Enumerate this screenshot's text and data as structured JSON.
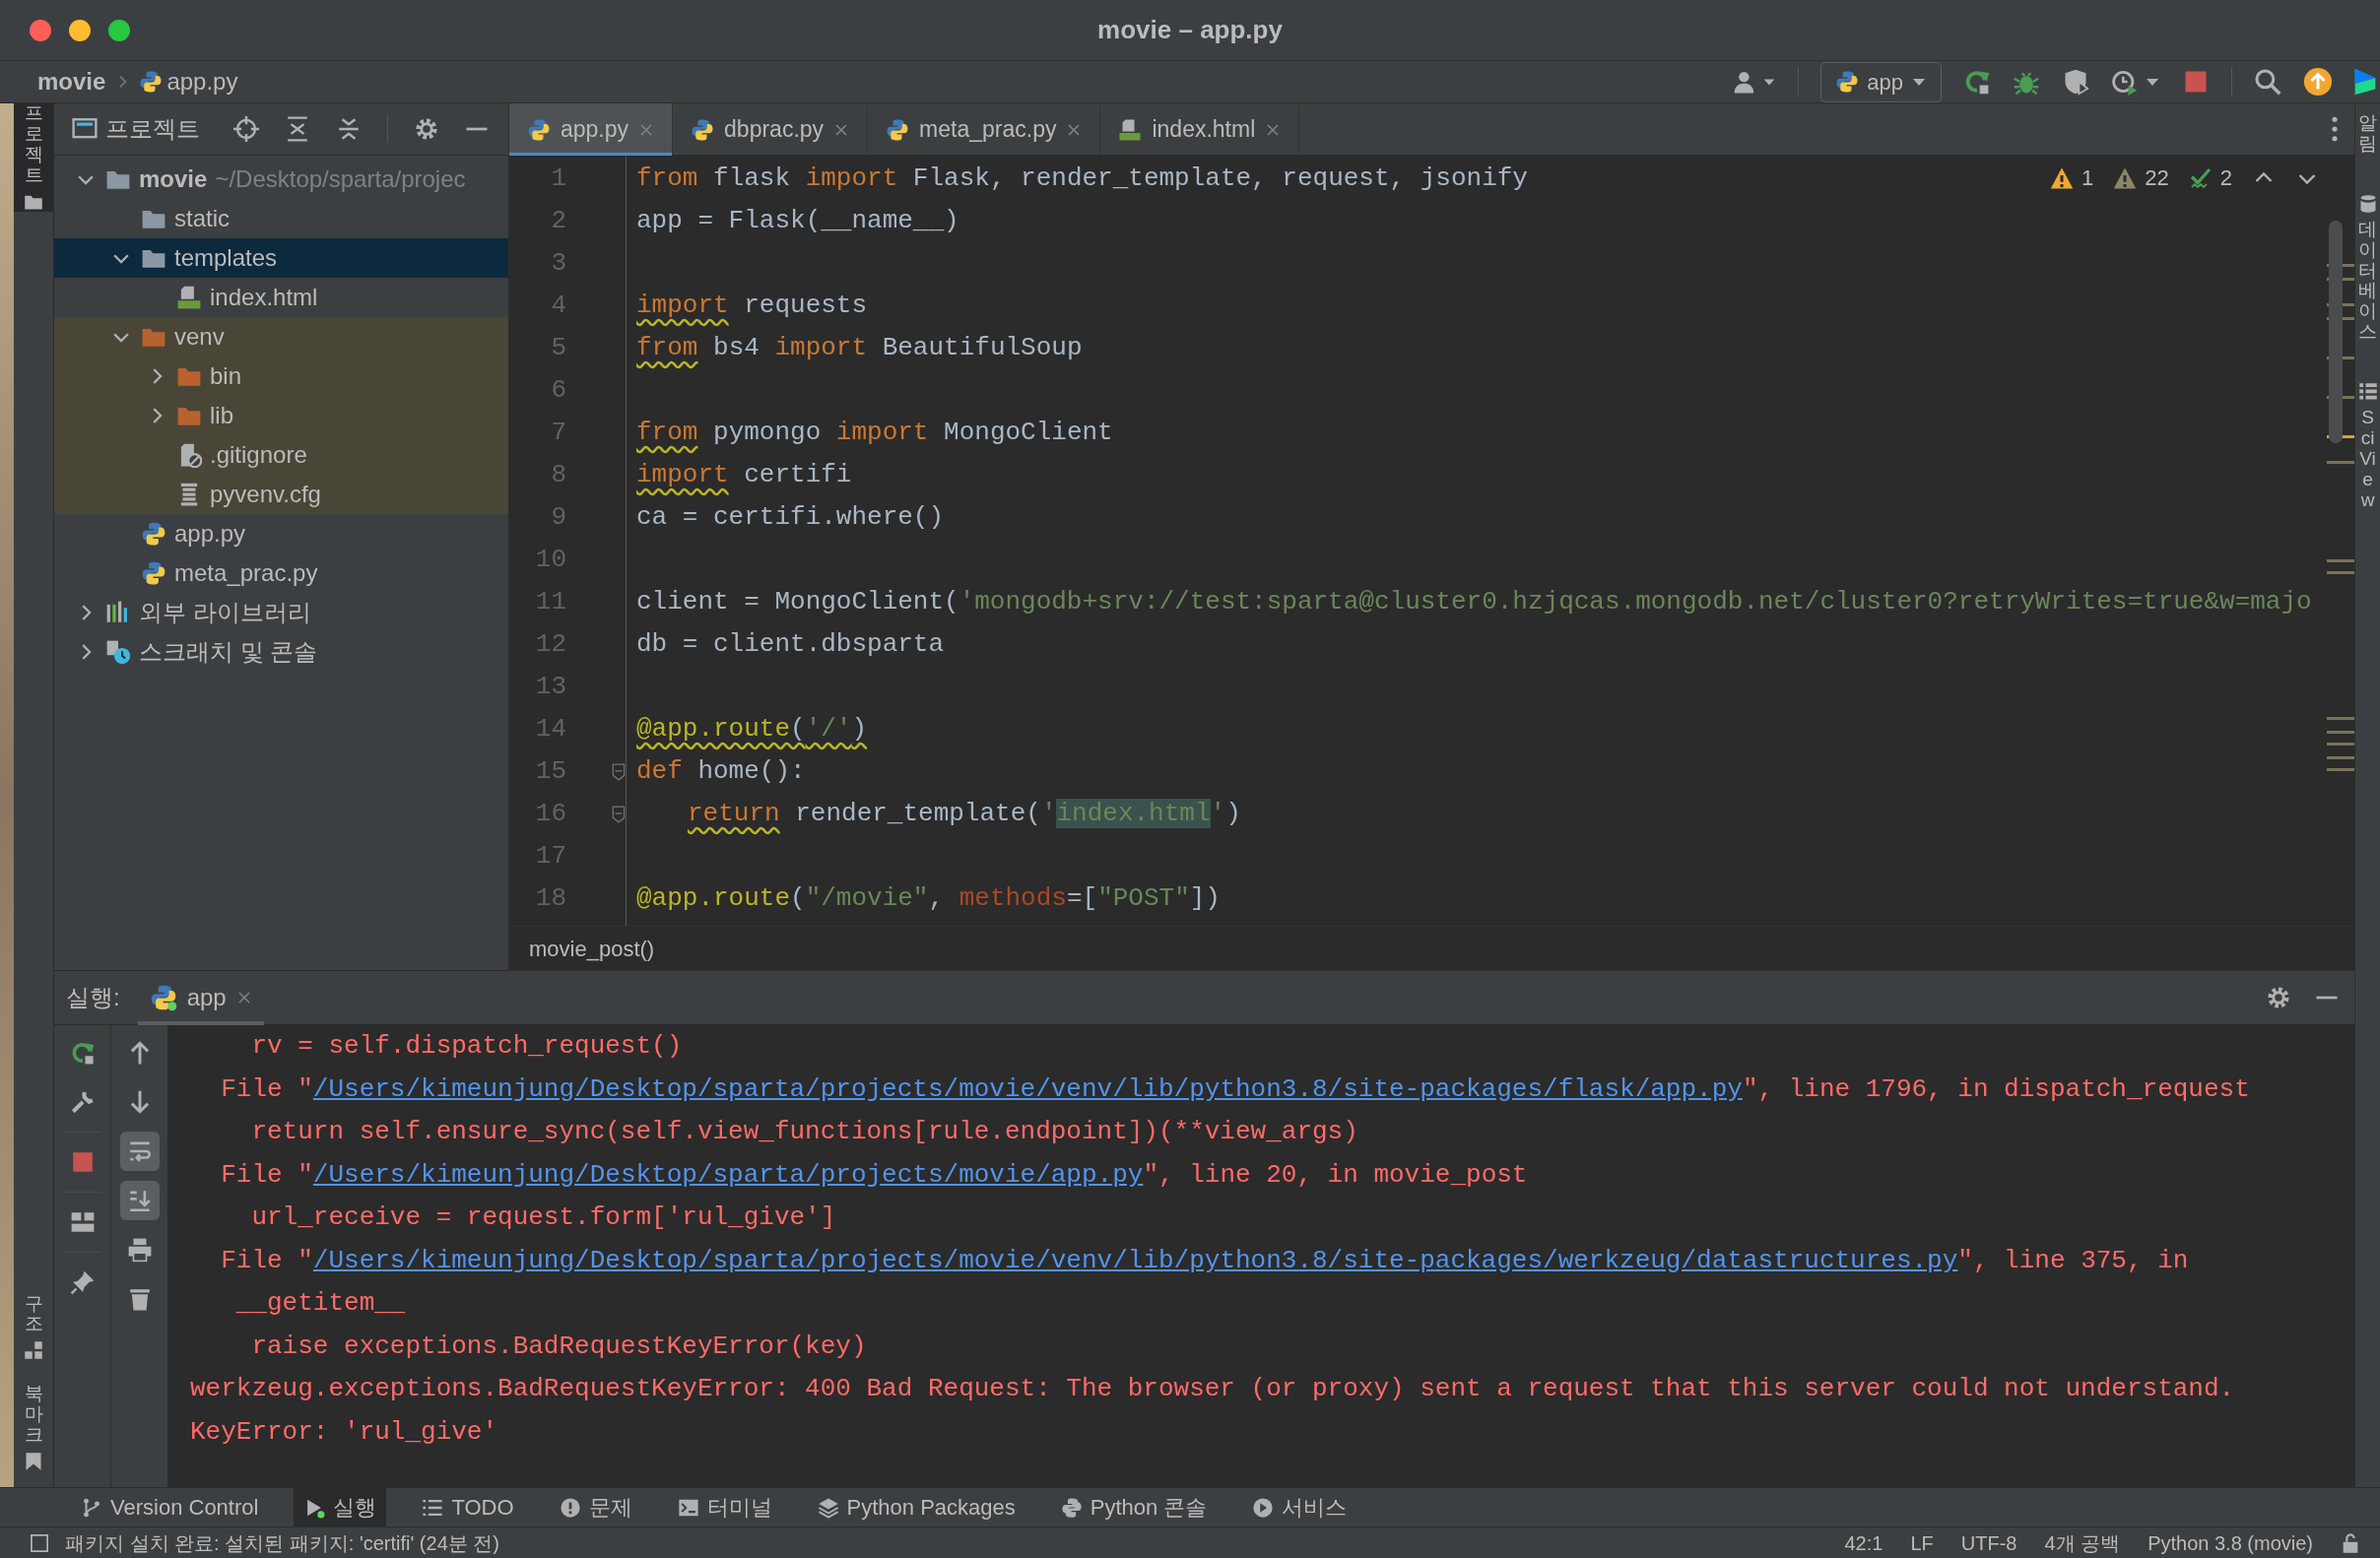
{
  "window": {
    "title": "movie – app.py"
  },
  "navbar": {
    "breadcrumbs": [
      {
        "label": "movie",
        "kind": "project"
      },
      {
        "label": "app.py",
        "kind": "python"
      }
    ],
    "run_config": "app"
  },
  "left_strip": {
    "top": [
      {
        "label": "프로젝트",
        "kind": "folder",
        "selected": true
      }
    ],
    "bottom": [
      {
        "label": "구조",
        "kind": "structure",
        "selected": false
      },
      {
        "label": "북마크",
        "kind": "bookmark",
        "selected": false
      }
    ]
  },
  "project_panel": {
    "title": "프로젝트",
    "tree": [
      {
        "label": "movie",
        "path": "~/Desktop/sparta/projec",
        "kind": "folder",
        "expanded": true,
        "selected": false,
        "children": [
          {
            "label": "static",
            "kind": "folder",
            "selected": false
          },
          {
            "label": "templates",
            "kind": "folder",
            "expanded": true,
            "selected": true,
            "children": [
              {
                "label": "index.html",
                "kind": "html",
                "selected": false
              }
            ]
          },
          {
            "label": "venv",
            "kind": "excluded-folder",
            "expanded": true,
            "excluded": true,
            "selected": false,
            "children": [
              {
                "label": "bin",
                "kind": "excluded-folder",
                "expanded": false,
                "selected": false
              },
              {
                "label": "lib",
                "kind": "excluded-folder",
                "expanded": false,
                "selected": false
              },
              {
                "label": ".gitignore",
                "kind": "gitignore",
                "selected": false
              },
              {
                "label": "pyvenv.cfg",
                "kind": "config",
                "selected": false
              }
            ]
          },
          {
            "label": "app.py",
            "kind": "python",
            "selected": false
          },
          {
            "label": "meta_prac.py",
            "kind": "python",
            "selected": false
          }
        ]
      },
      {
        "label": "외부 라이브러리",
        "kind": "library",
        "expanded": false,
        "selected": false
      },
      {
        "label": "스크래치 및 콘솔",
        "kind": "scratch",
        "expanded": false,
        "selected": false
      }
    ]
  },
  "editor": {
    "tabs": [
      {
        "label": "app.py",
        "kind": "python",
        "selected": true
      },
      {
        "label": "dbprac.py",
        "kind": "python",
        "selected": false
      },
      {
        "label": "meta_prac.py",
        "kind": "python",
        "selected": false
      },
      {
        "label": "index.html",
        "kind": "html",
        "selected": false
      }
    ],
    "inspections": [
      {
        "kind": "warning",
        "count": "1"
      },
      {
        "kind": "weak-warning",
        "count": "22"
      },
      {
        "kind": "typo",
        "count": "2"
      }
    ],
    "lines": [
      {
        "number": "1",
        "tokens": [
          {
            "kind": "keyword",
            "text": "from"
          },
          {
            "kind": "plain",
            "text": " flask "
          },
          {
            "kind": "keyword",
            "text": "import"
          },
          {
            "kind": "plain",
            "text": " Flask, render_template, request, jsonify"
          }
        ]
      },
      {
        "number": "2",
        "tokens": [
          {
            "kind": "plain",
            "text": "app = Flask(__name__)"
          }
        ]
      },
      {
        "number": "3"
      },
      {
        "number": "4",
        "tokens": [
          {
            "kind": "keyword",
            "text": "import",
            "warn": true
          },
          {
            "kind": "plain",
            "text": " requests"
          }
        ]
      },
      {
        "number": "5",
        "tokens": [
          {
            "kind": "keyword",
            "text": "from",
            "warn": true
          },
          {
            "kind": "plain",
            "text": " bs4 "
          },
          {
            "kind": "keyword",
            "text": "import"
          },
          {
            "kind": "plain",
            "text": " BeautifulSoup"
          }
        ]
      },
      {
        "number": "6"
      },
      {
        "number": "7",
        "tokens": [
          {
            "kind": "keyword",
            "text": "from",
            "warn": true
          },
          {
            "kind": "plain",
            "text": " pymongo "
          },
          {
            "kind": "keyword",
            "text": "import"
          },
          {
            "kind": "plain",
            "text": " MongoClient"
          }
        ]
      },
      {
        "number": "8",
        "tokens": [
          {
            "kind": "keyword",
            "text": "import",
            "warn": true
          },
          {
            "kind": "plain",
            "text": " certifi"
          }
        ]
      },
      {
        "number": "9",
        "tokens": [
          {
            "kind": "plain",
            "text": "ca = certifi.where()"
          }
        ]
      },
      {
        "number": "10"
      },
      {
        "number": "11",
        "tokens": [
          {
            "kind": "plain",
            "text": "client = MongoClient("
          },
          {
            "kind": "string",
            "text": "'mongodb+srv://test:sparta@cluster0.hzjqcas.mongodb.net/cluster0?retryWrites=true&w=majo"
          }
        ]
      },
      {
        "number": "12",
        "tokens": [
          {
            "kind": "plain",
            "text": "db = client.dbsparta"
          }
        ]
      },
      {
        "number": "13"
      },
      {
        "number": "14",
        "tokens": [
          {
            "kind": "decorator",
            "text": "@app.route",
            "warn": true
          },
          {
            "kind": "plain",
            "text": "(",
            "warn": true
          },
          {
            "kind": "string",
            "text": "'/'",
            "warn": true
          },
          {
            "kind": "plain",
            "text": ")",
            "warn": true
          }
        ]
      },
      {
        "number": "15",
        "fold": true,
        "tokens": [
          {
            "kind": "keyword",
            "text": "def"
          },
          {
            "kind": "plain",
            "text": " home():"
          }
        ]
      },
      {
        "number": "16",
        "fold": true,
        "indented": true,
        "tokens": [
          {
            "kind": "keyword",
            "text": "return",
            "warn": true
          },
          {
            "kind": "plain",
            "text": " render_template("
          },
          {
            "kind": "string",
            "text": "'"
          },
          {
            "kind": "string",
            "text": "index.html",
            "highlight": true
          },
          {
            "kind": "string",
            "text": "'"
          },
          {
            "kind": "plain",
            "text": ")"
          }
        ]
      },
      {
        "number": "17"
      },
      {
        "number": "18",
        "tokens": [
          {
            "kind": "decorator",
            "text": "@app.route"
          },
          {
            "kind": "plain",
            "text": "("
          },
          {
            "kind": "string",
            "text": "\"/movie\""
          },
          {
            "kind": "plain",
            "text": ", "
          },
          {
            "kind": "param",
            "text": "methods"
          },
          {
            "kind": "plain",
            "text": "=["
          },
          {
            "kind": "string",
            "text": "\"POST\""
          },
          {
            "kind": "plain",
            "text": "])"
          }
        ]
      }
    ],
    "breadcrumb": "movie_post()"
  },
  "right_strip": [
    {
      "label": "알림",
      "kind": "notifications"
    },
    {
      "label": "데이터베이스",
      "kind": "database"
    },
    {
      "label": "SciView",
      "kind": "sciview"
    }
  ],
  "run_panel": {
    "label": "실행:",
    "tabs": [
      {
        "label": "app",
        "selected": true
      }
    ],
    "actions": [
      {
        "kind": "rerun"
      },
      {
        "kind": "wrench"
      },
      {
        "kind": "stop"
      },
      {
        "kind": "layout"
      },
      {
        "kind": "pin"
      }
    ],
    "console_actions": [
      {
        "kind": "up",
        "on": false
      },
      {
        "kind": "down",
        "on": false
      },
      {
        "kind": "soft-wrap",
        "on": true
      },
      {
        "kind": "scroll-end",
        "on": true
      },
      {
        "kind": "print",
        "on": false
      },
      {
        "kind": "trash",
        "on": false
      }
    ],
    "lines": [
      [
        {
          "kind": "text",
          "text": "    rv = self.dispatch_request()"
        }
      ],
      [
        {
          "kind": "text",
          "text": "  File \""
        },
        {
          "kind": "link",
          "text": "/Users/kimeunjung/Desktop/sparta/projects/movie/venv/lib/python3.8/site-packages/flask/app.py"
        },
        {
          "kind": "text",
          "text": "\", line 1796, in dispatch_request"
        }
      ],
      [
        {
          "kind": "text",
          "text": "    return self.ensure_sync(self.view_functions[rule.endpoint])(**view_args)"
        }
      ],
      [
        {
          "kind": "text",
          "text": "  File \""
        },
        {
          "kind": "link",
          "text": "/Users/kimeunjung/Desktop/sparta/projects/movie/app.py"
        },
        {
          "kind": "text",
          "text": "\", line 20, in movie_post"
        }
      ],
      [
        {
          "kind": "text",
          "text": "    url_receive = request.form['rul_give']"
        }
      ],
      [
        {
          "kind": "text",
          "text": "  File \""
        },
        {
          "kind": "link",
          "text": "/Users/kimeunjung/Desktop/sparta/projects/movie/venv/lib/python3.8/site-packages/werkzeug/datastructures.py"
        },
        {
          "kind": "text",
          "text": "\", line 375, in"
        }
      ],
      [
        {
          "kind": "text",
          "text": "   __getitem__"
        }
      ],
      [
        {
          "kind": "text",
          "text": "    raise exceptions.BadRequestKeyError(key)"
        }
      ],
      [
        {
          "kind": "text",
          "text": "werkzeug.exceptions.BadRequestKeyError: 400 Bad Request: The browser (or proxy) sent a request that this server could not understand."
        }
      ],
      [
        {
          "kind": "text",
          "text": "KeyError: 'rul_give'"
        }
      ]
    ]
  },
  "tool_tabs": [
    {
      "label": "Version Control",
      "kind": "branch",
      "selected": false
    },
    {
      "label": "실행",
      "kind": "run",
      "selected": true
    },
    {
      "label": "TODO",
      "kind": "list",
      "selected": false
    },
    {
      "label": "문제",
      "kind": "problems",
      "selected": false
    },
    {
      "label": "터미널",
      "kind": "terminal",
      "selected": false
    },
    {
      "label": "Python Packages",
      "kind": "packages",
      "selected": false
    },
    {
      "label": "Python 콘솔",
      "kind": "python",
      "selected": false
    },
    {
      "label": "서비스",
      "kind": "services",
      "selected": false
    }
  ],
  "status_bar": {
    "message": "패키지 설치 완료: 설치된 패키지: 'certifi' (24분 전)",
    "items": [
      "42:1",
      "LF",
      "UTF-8",
      "4개 공백",
      "Python 3.8 (movie)"
    ]
  }
}
